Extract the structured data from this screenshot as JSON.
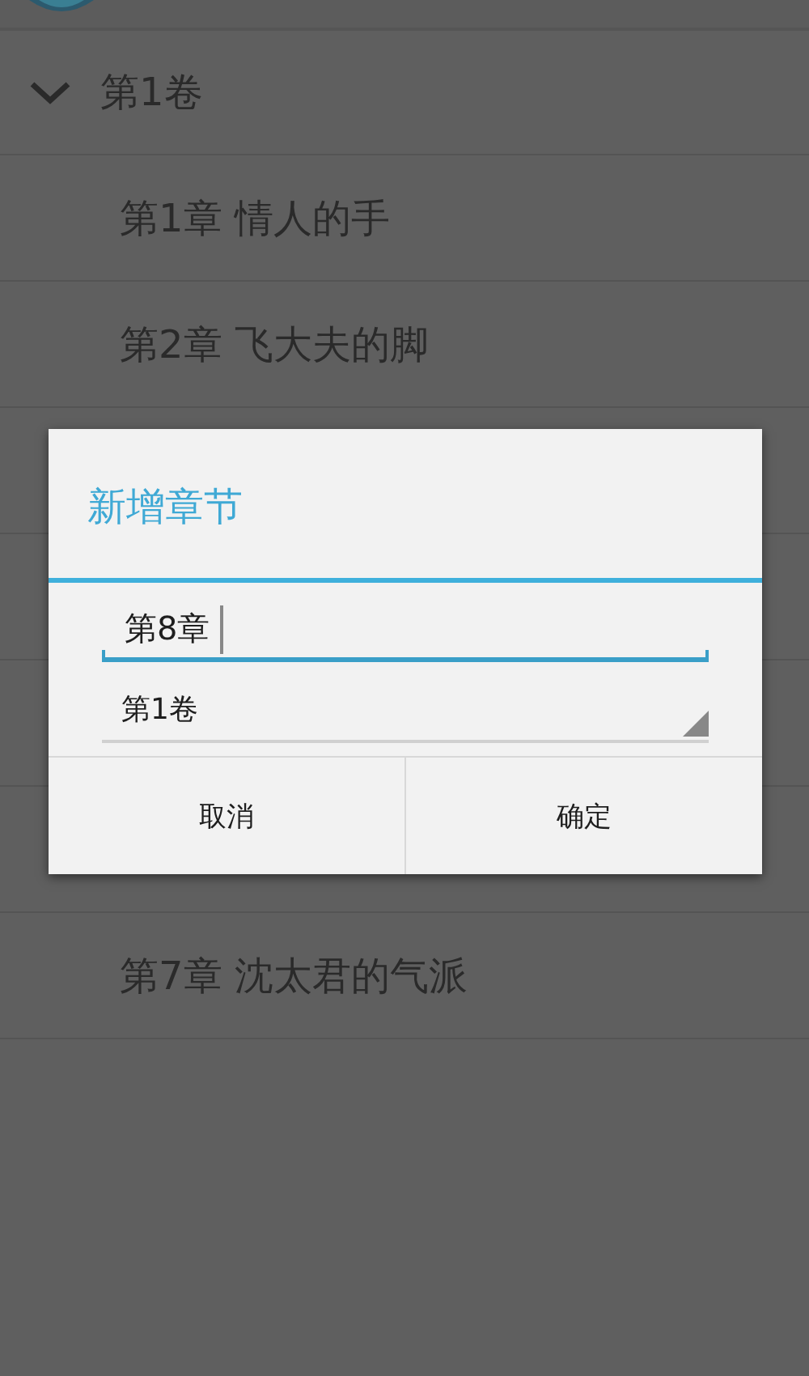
{
  "volume": {
    "title": "第1卷",
    "expanded": true
  },
  "chapters": [
    {
      "title": "第1章 情人的手"
    },
    {
      "title": "第2章 飞大夫的脚"
    }
  ],
  "last_chapter": {
    "title": "第7章 沈太君的气派"
  },
  "dialog": {
    "title": "新增章节",
    "name_field": {
      "value": "第8章"
    },
    "volume_select": {
      "value": "第1卷"
    },
    "buttons": [
      "取消",
      "确定"
    ]
  }
}
